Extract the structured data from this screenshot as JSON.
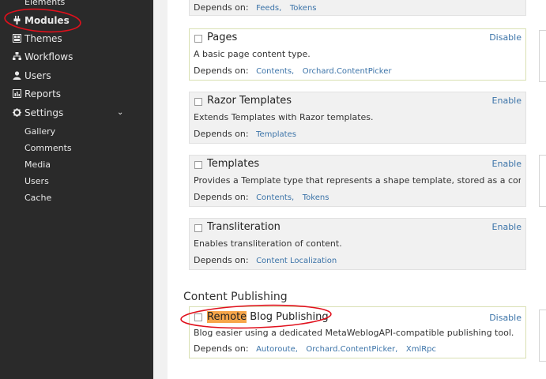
{
  "sidebar": {
    "top_cut_label": "Elements",
    "items": [
      {
        "label": "Modules",
        "icon": "plug-icon"
      },
      {
        "label": "Themes",
        "icon": "themes-icon"
      },
      {
        "label": "Workflows",
        "icon": "workflows-icon"
      },
      {
        "label": "Users",
        "icon": "user-icon"
      },
      {
        "label": "Reports",
        "icon": "reports-icon"
      },
      {
        "label": "Settings",
        "icon": "gear-icon"
      }
    ],
    "settings_caret": "chevron-down-icon",
    "sub_items": [
      "Gallery",
      "Comments",
      "Media",
      "Users",
      "Cache"
    ]
  },
  "modules": {
    "top_partial": {
      "depends_label": "Depends on:",
      "dependencies": [
        "Feeds,",
        "Tokens"
      ]
    },
    "cards": [
      {
        "title": "Pages",
        "action": "Disable",
        "description": "A basic page content type.",
        "depends_label": "Depends on:",
        "dependencies": [
          "Contents,",
          "Orchard.ContentPicker"
        ]
      },
      {
        "title": "Razor Templates",
        "action": "Enable",
        "description": "Extends Templates with Razor templates.",
        "depends_label": "Depends on:",
        "dependencies": [
          "Templates"
        ]
      },
      {
        "title": "Templates",
        "action": "Enable",
        "description": "Provides a Template type that represents a shape template, stored as a content ite...",
        "depends_label": "Depends on:",
        "dependencies": [
          "Contents,",
          "Tokens"
        ]
      },
      {
        "title": "Transliteration",
        "action": "Enable",
        "description": "Enables transliteration of content.",
        "depends_label": "Depends on:",
        "dependencies": [
          "Content Localization"
        ]
      }
    ],
    "section_title": "Content Publishing",
    "publishing_card": {
      "title_highlight": "Remote",
      "title_rest": " Blog Publishing",
      "action": "Disable",
      "description": "Blog easier using a dedicated MetaWeblogAPI-compatible publishing tool.",
      "depends_label": "Depends on:",
      "dependencies": [
        "Autoroute,",
        "Orchard.ContentPicker,",
        "XmlRpc"
      ]
    }
  },
  "colors": {
    "sidebar_bg": "#2a2a2a",
    "link": "#3b73a8",
    "search_highlight": "#f7a64a",
    "annotation": "#e0101c"
  }
}
